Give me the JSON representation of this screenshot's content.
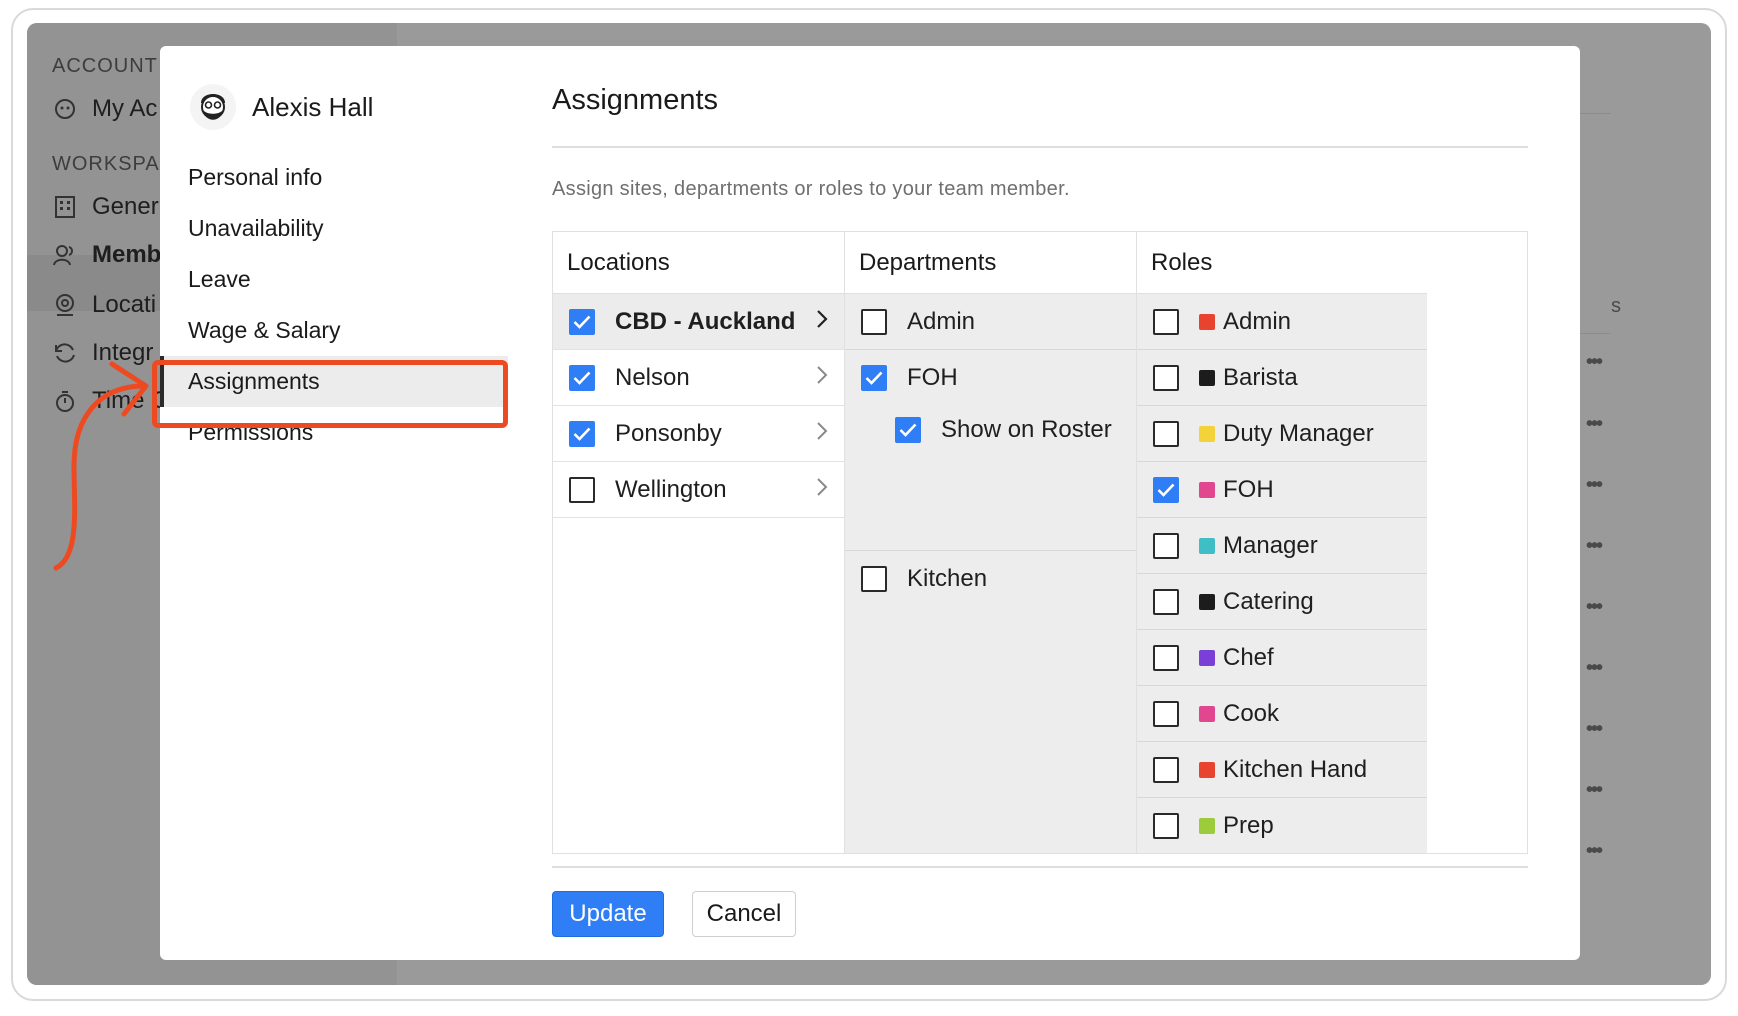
{
  "background": {
    "sections": [
      "ACCOUNT",
      "WORKSPAC"
    ],
    "items": [
      {
        "label": "My Ac",
        "icon": "account-icon"
      },
      {
        "label": "Gener",
        "icon": "building-icon"
      },
      {
        "label": "Memb",
        "icon": "members-icon"
      },
      {
        "label": "Locati",
        "icon": "location-icon"
      },
      {
        "label": "Integr",
        "icon": "sync-icon"
      },
      {
        "label": "Time C",
        "icon": "stopwatch-icon"
      }
    ],
    "right_partial_text": "s",
    "dots": "•••"
  },
  "user": {
    "name": "Alexis Hall"
  },
  "nav": [
    {
      "label": "Personal info",
      "active": false
    },
    {
      "label": "Unavailability",
      "active": false
    },
    {
      "label": "Leave",
      "active": false
    },
    {
      "label": "Wage & Salary",
      "active": false
    },
    {
      "label": "Assignments",
      "active": true
    },
    {
      "label": "Permissions",
      "active": false
    }
  ],
  "page": {
    "title": "Assignments",
    "subtitle": "Assign sites, departments or roles to your team member."
  },
  "columns": {
    "locations": "Locations",
    "departments": "Departments",
    "roles": "Roles"
  },
  "locations": [
    {
      "label": "CBD - Auckland",
      "checked": true,
      "selected": true
    },
    {
      "label": "Nelson",
      "checked": true,
      "selected": false
    },
    {
      "label": "Ponsonby",
      "checked": true,
      "selected": false
    },
    {
      "label": "Wellington",
      "checked": false,
      "selected": false
    }
  ],
  "departments": [
    {
      "label": "Admin",
      "checked": false,
      "sub": null
    },
    {
      "label": "FOH",
      "checked": true,
      "sub": {
        "label": "Show on Roster",
        "checked": true
      }
    },
    {
      "label": "Kitchen",
      "checked": false,
      "sub": null
    }
  ],
  "roles": [
    {
      "label": "Admin",
      "checked": false,
      "color": "#e8432e"
    },
    {
      "label": "Barista",
      "checked": false,
      "color": "#1c1c1c"
    },
    {
      "label": "Duty Manager",
      "checked": false,
      "color": "#f4d23a"
    },
    {
      "label": "FOH",
      "checked": true,
      "color": "#e0478f"
    },
    {
      "label": "Manager",
      "checked": false,
      "color": "#3fbec6"
    },
    {
      "label": "Catering",
      "checked": false,
      "color": "#1c1c1c"
    },
    {
      "label": "Chef",
      "checked": false,
      "color": "#7a3fd6"
    },
    {
      "label": "Cook",
      "checked": false,
      "color": "#e0478f"
    },
    {
      "label": "Kitchen Hand",
      "checked": false,
      "color": "#e8432e"
    },
    {
      "label": "Prep",
      "checked": false,
      "color": "#9ccc3c"
    }
  ],
  "actions": {
    "update": "Update",
    "cancel": "Cancel"
  },
  "annotation_color": "#ee4a22"
}
